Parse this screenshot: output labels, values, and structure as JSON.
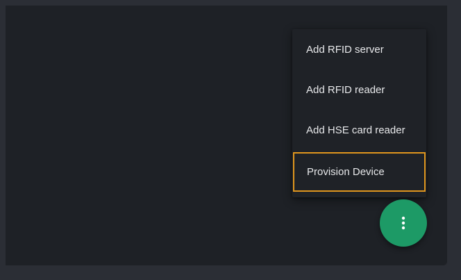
{
  "menu": {
    "items": [
      {
        "label": "Add RFID server"
      },
      {
        "label": "Add RFID reader"
      },
      {
        "label": "Add HSE card reader"
      },
      {
        "label": "Provision Device"
      }
    ],
    "focused_index": 3
  },
  "fab": {
    "icon": "more-vertical-icon"
  },
  "colors": {
    "panel_background": "#1e2126",
    "page_background": "#2b2e35",
    "fab_background": "#1d9a66",
    "focus_outline": "#e0961d",
    "menu_text": "#e8e9eb"
  }
}
